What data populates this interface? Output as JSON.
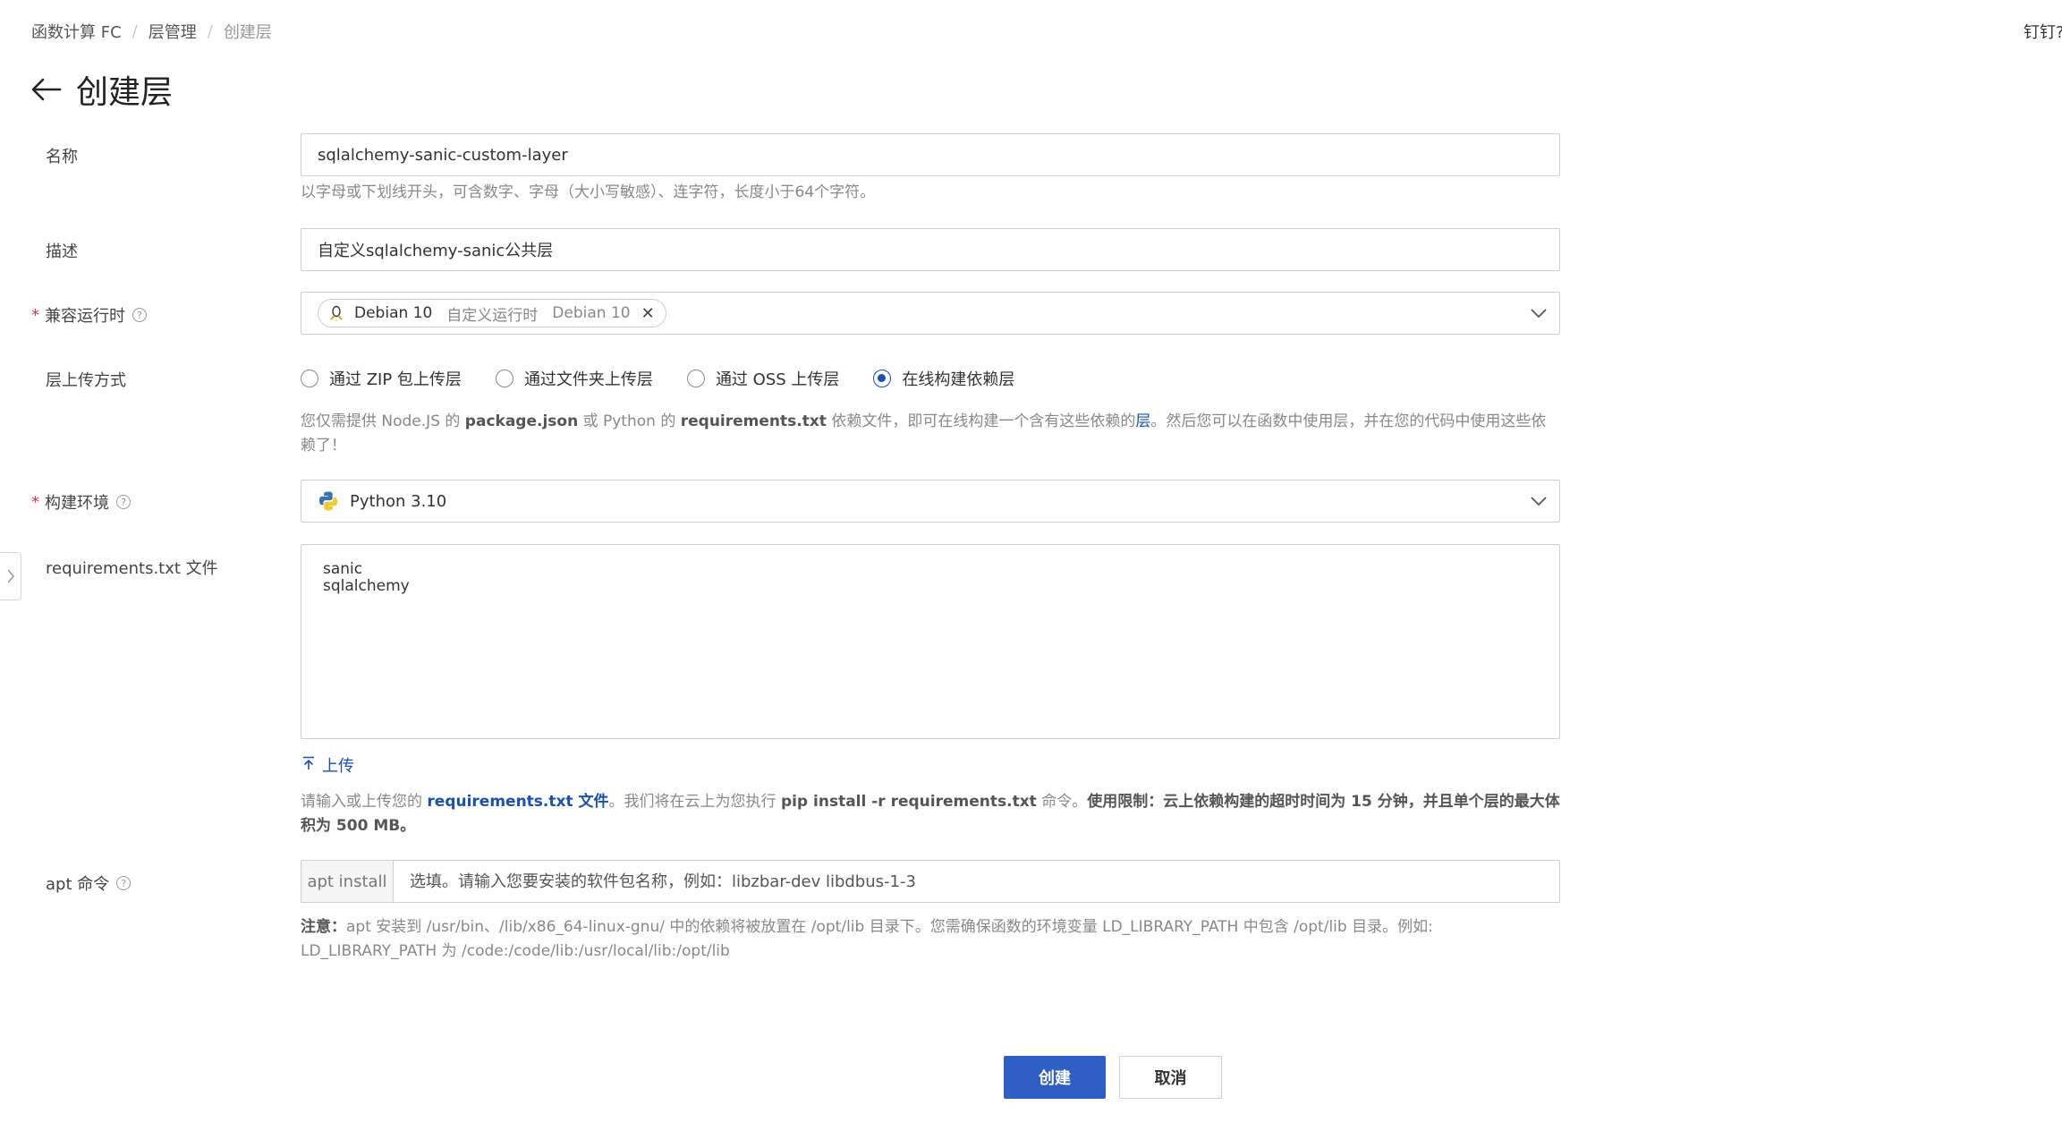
{
  "breadcrumb": {
    "items": [
      "函数计算 FC",
      "层管理",
      "创建层"
    ],
    "separator": "/"
  },
  "top_right": {
    "text": "钉钉?"
  },
  "header": {
    "title": "创建层"
  },
  "form": {
    "name": {
      "label": "名称",
      "value": "sqlalchemy-sanic-custom-layer",
      "hint": "以字母或下划线开头，可含数字、字母（大小写敏感）、连字符，长度小于64个字符。"
    },
    "description": {
      "label": "描述",
      "value": "自定义sqlalchemy-sanic公共层"
    },
    "runtime": {
      "label": "兼容运行时",
      "tag_name": "Debian 10",
      "tag_sub1": "自定义运行时",
      "tag_sub2": "Debian 10",
      "tag_close": "✕"
    },
    "upload_method": {
      "label": "层上传方式",
      "options": [
        "通过 ZIP 包上传层",
        "通过文件夹上传层",
        "通过 OSS 上传层",
        "在线构建依赖层"
      ],
      "selected_index": 3,
      "hint_parts": {
        "p1": "您仅需提供 Node.JS 的 ",
        "b1": "package.json",
        "p2": " 或 Python 的 ",
        "b2": "requirements.txt",
        "p3": " 依赖文件，即可在线构建一个含有这些依赖的",
        "link": "层",
        "p4": "。然后您可以在函数中使用层，并在您的代码中使用这些依赖了！"
      }
    },
    "build_env": {
      "label": "构建环境",
      "value": "Python 3.10"
    },
    "requirements": {
      "label": "requirements.txt 文件",
      "content": "sanic\nsqlalchemy",
      "upload_label": "上传",
      "hint_parts": {
        "p1": "请输入或上传您的 ",
        "link": "requirements.txt 文件",
        "p2": "。我们将在云上为您执行 ",
        "b1": "pip install -r requirements.txt",
        "p3": " 命令。",
        "b2": "使用限制：云上依赖构建的超时时间为 15 分钟，并且单个层的最大体积为 500 MB。"
      }
    },
    "apt": {
      "label": "apt 命令",
      "addon": "apt install",
      "placeholder": "选填。请输入您要安装的软件包名称，例如：libzbar-dev libdbus-1-3",
      "hint_bold": "注意：",
      "hint_text": "apt 安装到 /usr/bin、/lib/x86_64-linux-gnu/ 中的依赖将被放置在 /opt/lib 目录下。您需确保函数的环境变量 LD_LIBRARY_PATH 中包含 /opt/lib 目录。例如: LD_LIBRARY_PATH 为 /code:/code/lib:/usr/local/lib:/opt/lib"
    },
    "required_mark": "*",
    "help_mark": "?"
  },
  "actions": {
    "create": "创建",
    "cancel": "取消"
  },
  "colors": {
    "primary": "#2f5ec4",
    "link": "#1a4fb4",
    "required": "#e4393c",
    "border": "#cfcfcf"
  }
}
